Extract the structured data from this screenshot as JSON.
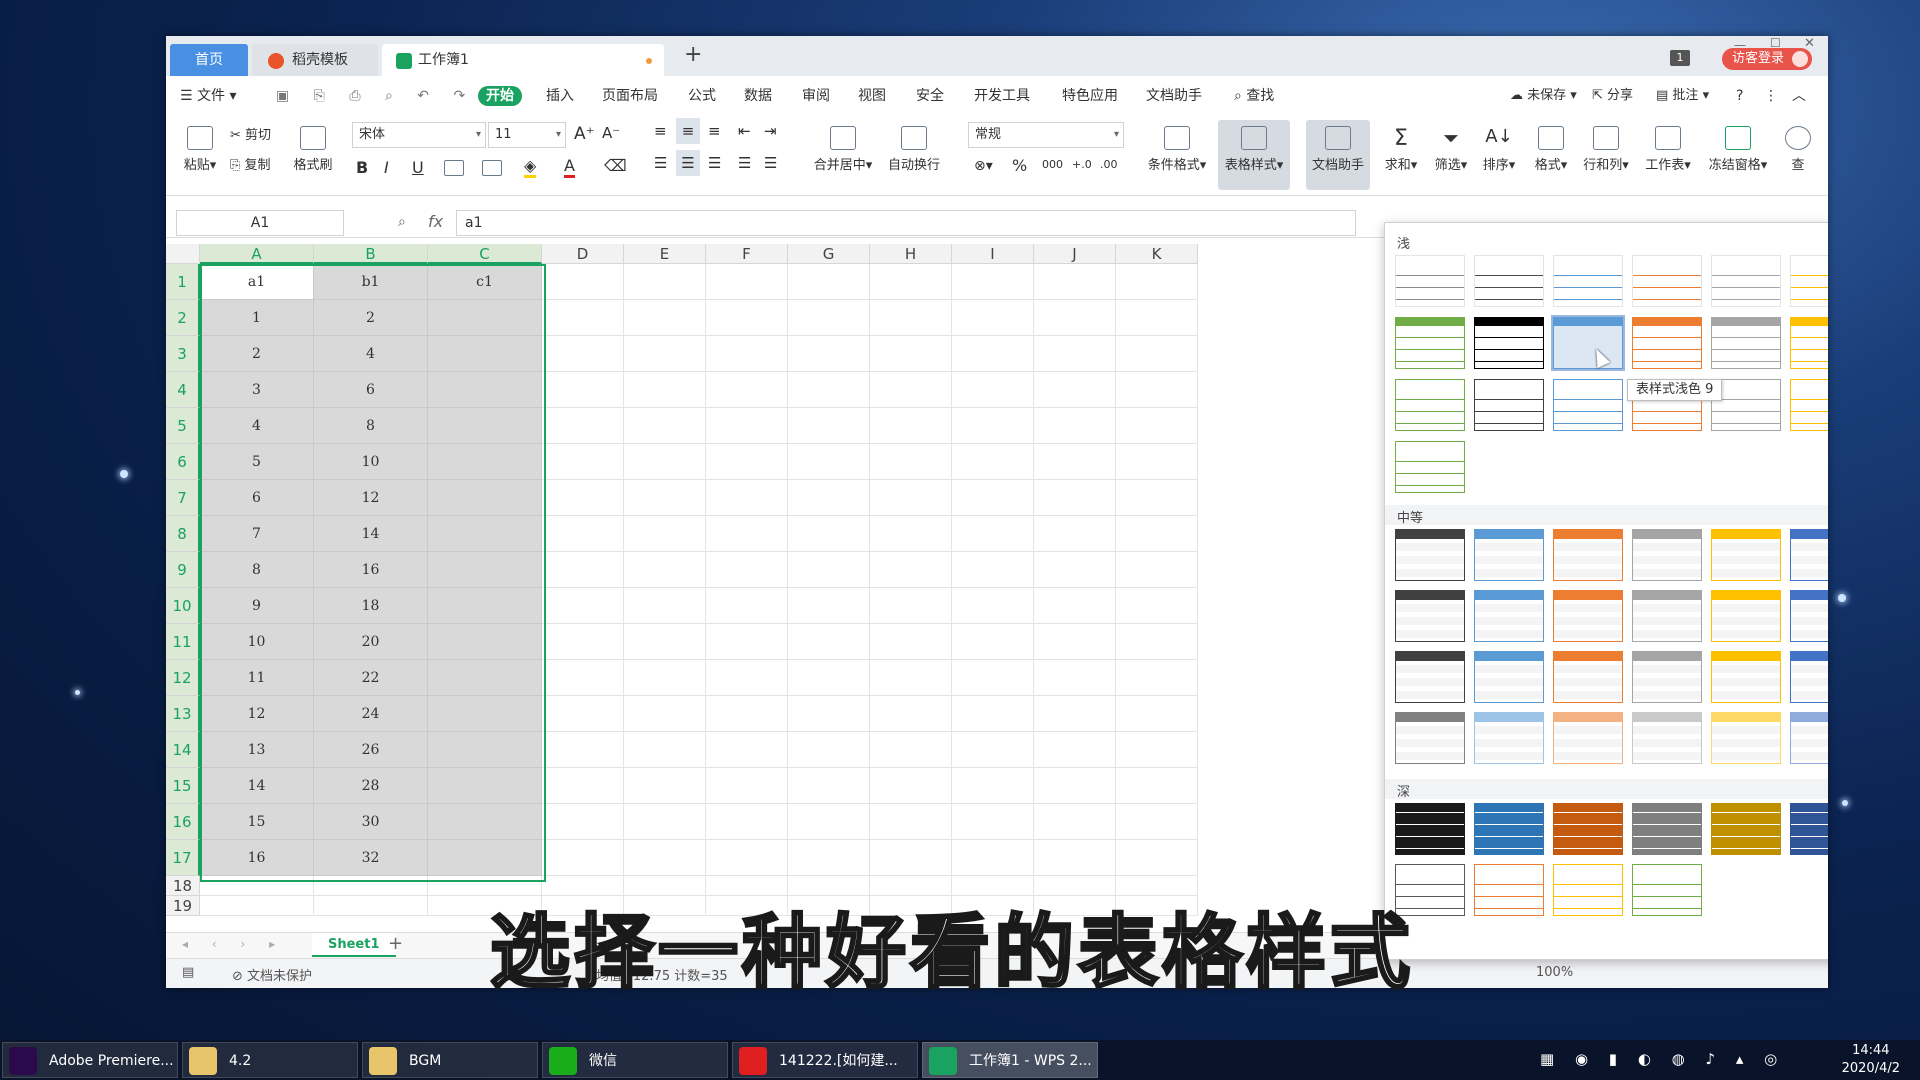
{
  "window": {
    "tabs": [
      {
        "label": "首页"
      },
      {
        "label": "稻壳模板"
      },
      {
        "label": "工作簿1"
      }
    ],
    "new_tab": "+",
    "guest_login": "访客登录",
    "badge": "1"
  },
  "menu": {
    "file": "文件",
    "items": [
      "开始",
      "插入",
      "页面布局",
      "公式",
      "数据",
      "审阅",
      "视图",
      "安全",
      "开发工具",
      "特色应用",
      "文档助手"
    ],
    "search": "查找",
    "unsaved": "未保存",
    "share": "分享",
    "comment": "批注",
    "help": "?"
  },
  "ribbon": {
    "paste": "粘贴",
    "cut": "剪切",
    "copy": "复制",
    "format_painter": "格式刷",
    "font_name": "宋体",
    "font_size": "11",
    "bold": "B",
    "italic": "I",
    "underline": "U",
    "merge_center": "合并居中",
    "wrap": "自动换行",
    "number_format": "常规",
    "percent": "%",
    "thousands": "000",
    "cond_format": "条件格式",
    "table_style": "表格样式",
    "doc_helper": "文档助手",
    "sum": "求和",
    "filter": "筛选",
    "sort": "排序",
    "format": "格式",
    "row_col": "行和列",
    "worksheet": "工作表",
    "freeze": "冻结窗格",
    "find": "查"
  },
  "formula_bar": {
    "name_box": "A1",
    "fx": "fx",
    "value": "a1"
  },
  "grid": {
    "columns": [
      "A",
      "B",
      "C",
      "D",
      "E",
      "F",
      "G",
      "H",
      "I",
      "J",
      "K"
    ],
    "rows": [
      [
        "a1",
        "b1",
        "c1"
      ],
      [
        "1",
        "2",
        ""
      ],
      [
        "2",
        "4",
        ""
      ],
      [
        "3",
        "6",
        ""
      ],
      [
        "4",
        "8",
        ""
      ],
      [
        "5",
        "10",
        ""
      ],
      [
        "6",
        "12",
        ""
      ],
      [
        "7",
        "14",
        ""
      ],
      [
        "8",
        "16",
        ""
      ],
      [
        "9",
        "18",
        ""
      ],
      [
        "10",
        "20",
        ""
      ],
      [
        "11",
        "22",
        ""
      ],
      [
        "12",
        "24",
        ""
      ],
      [
        "13",
        "26",
        ""
      ],
      [
        "14",
        "28",
        ""
      ],
      [
        "15",
        "30",
        ""
      ],
      [
        "16",
        "32",
        ""
      ],
      [
        "",
        "",
        ""
      ],
      [
        "",
        "",
        ""
      ]
    ]
  },
  "gallery": {
    "sections": {
      "light": "浅",
      "medium": "中等",
      "dark": "深"
    },
    "tooltip": "表样式浅色 9",
    "colors": {
      "light": [
        "#8a8a8a",
        "#4d4d4d",
        "#5b9bd5",
        "#ed7d31",
        "#a5a5a5",
        "#ffc000",
        "#4472c4",
        "#70ad47",
        "#000000",
        "#5b9bd5",
        "#ed7d31",
        "#a5a5a5",
        "#ffc000",
        "#4472c4",
        "#70ad47",
        "#404040",
        "#5b9bd5",
        "#ed7d31",
        "#a5a5a5",
        "#ffc000",
        "#4472c4",
        "#70ad47"
      ],
      "medium": [
        "#404040",
        "#5b9bd5",
        "#ed7d31",
        "#a5a5a5",
        "#ffc000",
        "#4472c4",
        "#70ad47",
        "#404040",
        "#5b9bd5",
        "#ed7d31",
        "#a5a5a5",
        "#ffc000",
        "#4472c4",
        "#70ad47",
        "#404040",
        "#5b9bd5",
        "#ed7d31",
        "#a5a5a5",
        "#ffc000",
        "#4472c4",
        "#70ad47",
        "#808080",
        "#9dc3e6",
        "#f4b183",
        "#c9c9c9",
        "#ffd966",
        "#8faadc",
        "#a9d18e"
      ],
      "dark": [
        "#1a1a1a",
        "#2e75b6",
        "#c55a11",
        "#7f7f7f",
        "#bf9000",
        "#2f5597",
        "#548235",
        "#595959",
        "#ed7d31",
        "#ffc000",
        "#70ad47"
      ]
    }
  },
  "sheets": {
    "active": "Sheet1",
    "add": "+"
  },
  "status": {
    "protect": "文档未保护",
    "stats": "均值=12.75  计数=35",
    "zoom": "100%"
  },
  "subtitle": "选择一种好看的表格样式",
  "taskbar": [
    {
      "label": "Adobe Premiere...",
      "color": "#2a0a4a"
    },
    {
      "label": "4.2",
      "color": "#e8c46a"
    },
    {
      "label": "BGM",
      "color": "#e8c46a"
    },
    {
      "label": "微信",
      "color": "#1aad19"
    },
    {
      "label": "141222.[如何建...",
      "color": "#e02020"
    },
    {
      "label": "工作簿1 - WPS 2...",
      "color": "#1aa260"
    }
  ],
  "clock": {
    "time": "14:44",
    "date": "2020/4/2"
  }
}
